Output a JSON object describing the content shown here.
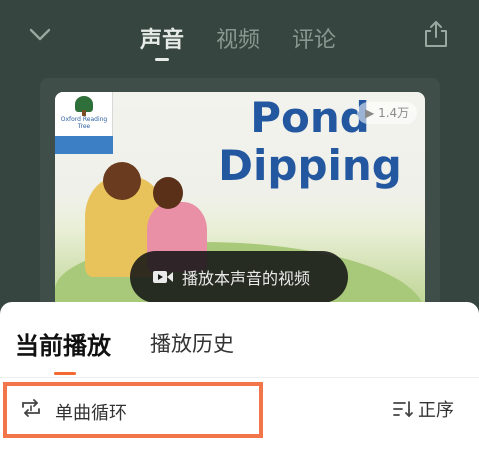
{
  "header": {
    "tabs": [
      {
        "label": "声音",
        "active": true
      },
      {
        "label": "视频",
        "active": false
      },
      {
        "label": "评论",
        "active": false
      }
    ],
    "icons": {
      "collapse": "chevron-down-icon",
      "share": "share-icon"
    }
  },
  "media": {
    "cover_title_line1": "Pond",
    "cover_title_line2": "Dipping",
    "logo_text": "Oxford Reading Tree",
    "play_count": "1.4万",
    "play_video_label": "播放本声音的视频",
    "play_video_icon": "video-camera-icon"
  },
  "sheet": {
    "tabs": [
      {
        "label": "当前播放",
        "active": true
      },
      {
        "label": "播放历史",
        "active": false
      }
    ],
    "loop_mode": {
      "label": "单曲循环",
      "icon": "repeat-one-icon"
    },
    "order": {
      "label": "正序",
      "icon": "sort-order-icon"
    },
    "accent_color": "#f26a32",
    "highlight_color": "#f2764a"
  }
}
